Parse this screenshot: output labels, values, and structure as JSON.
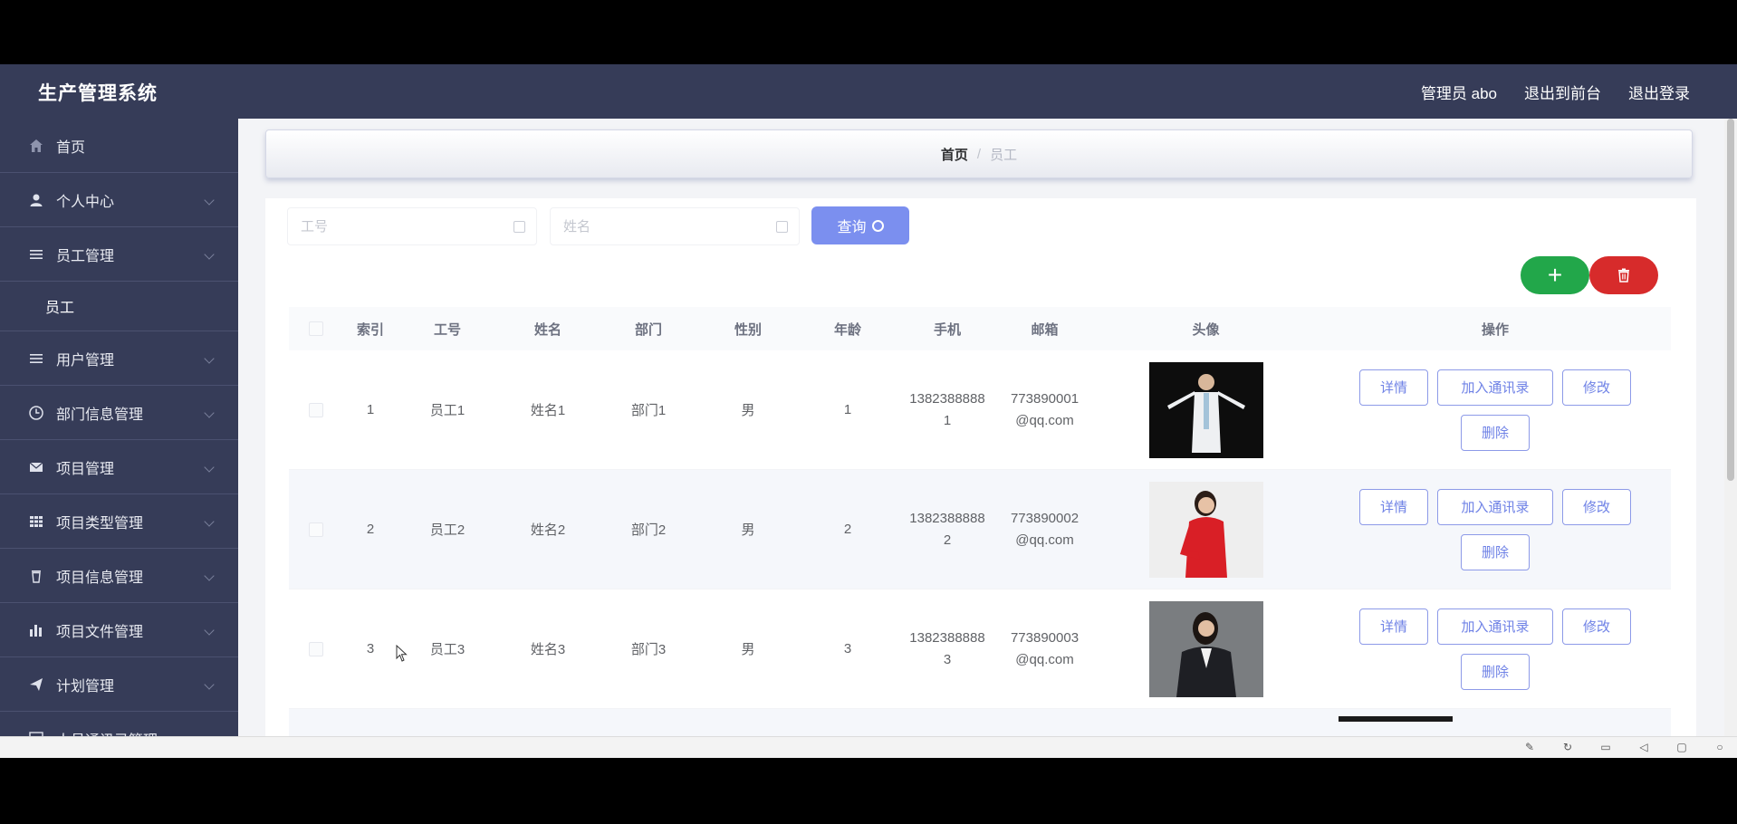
{
  "app": {
    "title": "生产管理系统",
    "nav": {
      "admin": "管理员 abo",
      "front": "退出到前台",
      "logout": "退出登录"
    }
  },
  "sidebar": {
    "items": [
      {
        "label": "首页",
        "icon": "home-icon",
        "chevron": false
      },
      {
        "label": "个人中心",
        "icon": "user-icon",
        "chevron": true
      },
      {
        "label": "员工管理",
        "icon": "list-icon",
        "chevron": true
      },
      {
        "label": "员工",
        "icon": "",
        "chevron": false,
        "sub": true
      },
      {
        "label": "用户管理",
        "icon": "list-icon",
        "chevron": true
      },
      {
        "label": "部门信息管理",
        "icon": "clock-icon",
        "chevron": true
      },
      {
        "label": "项目管理",
        "icon": "mail-icon",
        "chevron": true
      },
      {
        "label": "项目类型管理",
        "icon": "grid-icon",
        "chevron": true
      },
      {
        "label": "项目信息管理",
        "icon": "trash-icon",
        "chevron": true
      },
      {
        "label": "项目文件管理",
        "icon": "bar-chart-icon",
        "chevron": true
      },
      {
        "label": "计划管理",
        "icon": "send-icon",
        "chevron": true
      },
      {
        "label": "人员通讯录管理",
        "icon": "contacts-icon",
        "chevron": true
      }
    ]
  },
  "breadcrumb": {
    "home": "首页",
    "separator": "/",
    "current": "员工"
  },
  "search": {
    "field1_placeholder": "工号",
    "field2_placeholder": "姓名",
    "button_label": "查询"
  },
  "toolbar": {
    "add_label": "+"
  },
  "table": {
    "headers": [
      "索引",
      "工号",
      "姓名",
      "部门",
      "性别",
      "年龄",
      "手机",
      "邮箱",
      "头像",
      "操作"
    ],
    "rows": [
      {
        "index": "1",
        "no": "员工1",
        "name": "姓名1",
        "dept": "部门1",
        "sex": "男",
        "age": "1",
        "phone": "13823888881",
        "email": "773890001@qq.com"
      },
      {
        "index": "2",
        "no": "员工2",
        "name": "姓名2",
        "dept": "部门2",
        "sex": "男",
        "age": "2",
        "phone": "13823888882",
        "email": "773890002@qq.com"
      },
      {
        "index": "3",
        "no": "员工3",
        "name": "姓名3",
        "dept": "部门3",
        "sex": "男",
        "age": "3",
        "phone": "13823888883",
        "email": "773890003@qq.com"
      }
    ],
    "ops": {
      "detail": "详情",
      "contact": "加入通讯录",
      "edit": "修改",
      "delete": "删除"
    }
  },
  "colors": {
    "sidebar_bg": "#363c58",
    "primary": "#7b8fef",
    "add": "#22a74a",
    "delete": "#d72b2b"
  }
}
